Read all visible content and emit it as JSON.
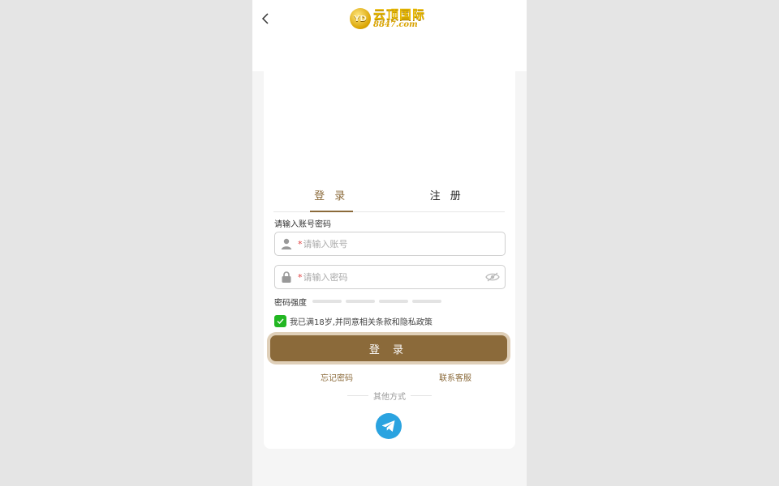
{
  "header": {
    "back_icon": "chevron-left-icon",
    "logo_cn": "云顶国际",
    "logo_en": "8847.com",
    "logo_mark": "YD"
  },
  "tabs": [
    {
      "label": "登 录",
      "active": true
    },
    {
      "label": "注 册",
      "active": false
    }
  ],
  "form": {
    "label": "请输入账号密码",
    "required_mark": "*",
    "username": {
      "value": "",
      "placeholder": "请输入账号",
      "icon": "user-icon"
    },
    "password": {
      "value": "",
      "placeholder": "请输入密码",
      "icon": "lock-icon",
      "toggle_icon": "eye-off-icon"
    },
    "strength_label": "密码强度",
    "agreement": {
      "checked": true,
      "text": "我已满18岁,并同意相关条款和隐私政策"
    },
    "submit_label": "登 录"
  },
  "links": {
    "left": "忘记密码",
    "right": "联系客服"
  },
  "divider_text": "其他方式",
  "social": {
    "icon": "telegram-icon"
  },
  "colors": {
    "accent": "#8b6a3a",
    "checkbox": "#22b722",
    "telegram": "#2aa3e0",
    "logo_gold": "#e8b800"
  }
}
